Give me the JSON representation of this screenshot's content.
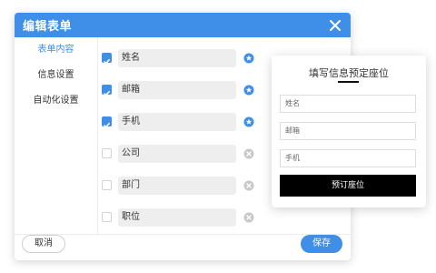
{
  "modal": {
    "title": "编辑表单",
    "close_icon": "close-icon"
  },
  "sidebar": {
    "items": [
      {
        "label": "表单内容",
        "active": true
      },
      {
        "label": "信息设置",
        "active": false
      },
      {
        "label": "自动化设置",
        "active": false
      }
    ]
  },
  "fields": [
    {
      "label": "姓名",
      "checked": true,
      "icon": "star-badge-icon"
    },
    {
      "label": "邮箱",
      "checked": true,
      "icon": "star-badge-icon"
    },
    {
      "label": "手机",
      "checked": true,
      "icon": "star-badge-icon"
    },
    {
      "label": "公司",
      "checked": false,
      "icon": "close-circle-icon"
    },
    {
      "label": "部门",
      "checked": false,
      "icon": "close-circle-icon"
    },
    {
      "label": "职位",
      "checked": false,
      "icon": "close-circle-icon"
    }
  ],
  "footer": {
    "cancel_label": "取消",
    "save_label": "保存"
  },
  "preview": {
    "title": "填写信息预定座位",
    "inputs": [
      {
        "placeholder": "姓名"
      },
      {
        "placeholder": "邮箱"
      },
      {
        "placeholder": "手机"
      }
    ],
    "submit_label": "预订座位"
  },
  "colors": {
    "accent": "#3f8ee7",
    "field_bg": "#eeeeee",
    "submit_bg": "#000000",
    "inactive_icon": "#c8c8c8"
  }
}
